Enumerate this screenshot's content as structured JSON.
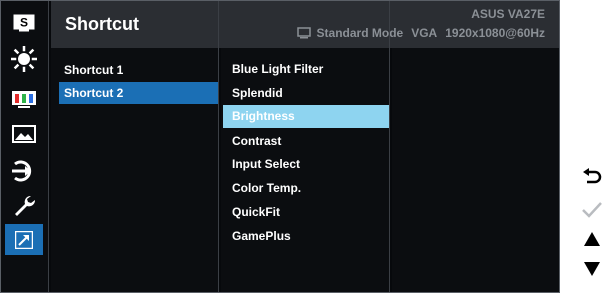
{
  "sidebar": {
    "items": [
      {
        "icon": "splendid-s-icon",
        "active": false
      },
      {
        "icon": "brightness-sun-icon",
        "active": false
      },
      {
        "icon": "color-bars-icon",
        "active": false
      },
      {
        "icon": "image-icon",
        "active": false
      },
      {
        "icon": "input-select-icon",
        "active": false
      },
      {
        "icon": "system-setup-wrench-icon",
        "active": false
      },
      {
        "icon": "shortcut-arrow-icon",
        "active": true
      }
    ],
    "badge_letter": "S"
  },
  "header": {
    "title": "Shortcut",
    "model": "ASUS  VA27E",
    "mode": "Standard Mode",
    "input": "VGA",
    "resolution": "1920x1080@60Hz"
  },
  "shortcut_list": [
    {
      "label": "Shortcut 1",
      "selected": false
    },
    {
      "label": "Shortcut 2",
      "selected": true
    }
  ],
  "function_list": [
    {
      "label": "Blue Light Filter",
      "highlighted": false
    },
    {
      "label": "Splendid",
      "highlighted": false
    },
    {
      "label": "Brightness",
      "highlighted": true
    },
    {
      "label": "Contrast",
      "highlighted": false
    },
    {
      "label": "Input Select",
      "highlighted": false
    },
    {
      "label": "Color Temp.",
      "highlighted": false
    },
    {
      "label": "QuickFit",
      "highlighted": false
    },
    {
      "label": "GamePlus",
      "highlighted": false
    }
  ],
  "nav_keys": [
    {
      "icon": "back-icon",
      "enabled": true
    },
    {
      "icon": "checkmark-icon",
      "enabled": false
    },
    {
      "icon": "up-arrow-icon",
      "enabled": true
    },
    {
      "icon": "down-arrow-icon",
      "enabled": true
    }
  ],
  "colors": {
    "panel": "#0b0d10",
    "header": "#2b2e33",
    "selected": "#1b6fb5",
    "highlight": "#8ed4f0",
    "muted_text": "#8b9096"
  }
}
